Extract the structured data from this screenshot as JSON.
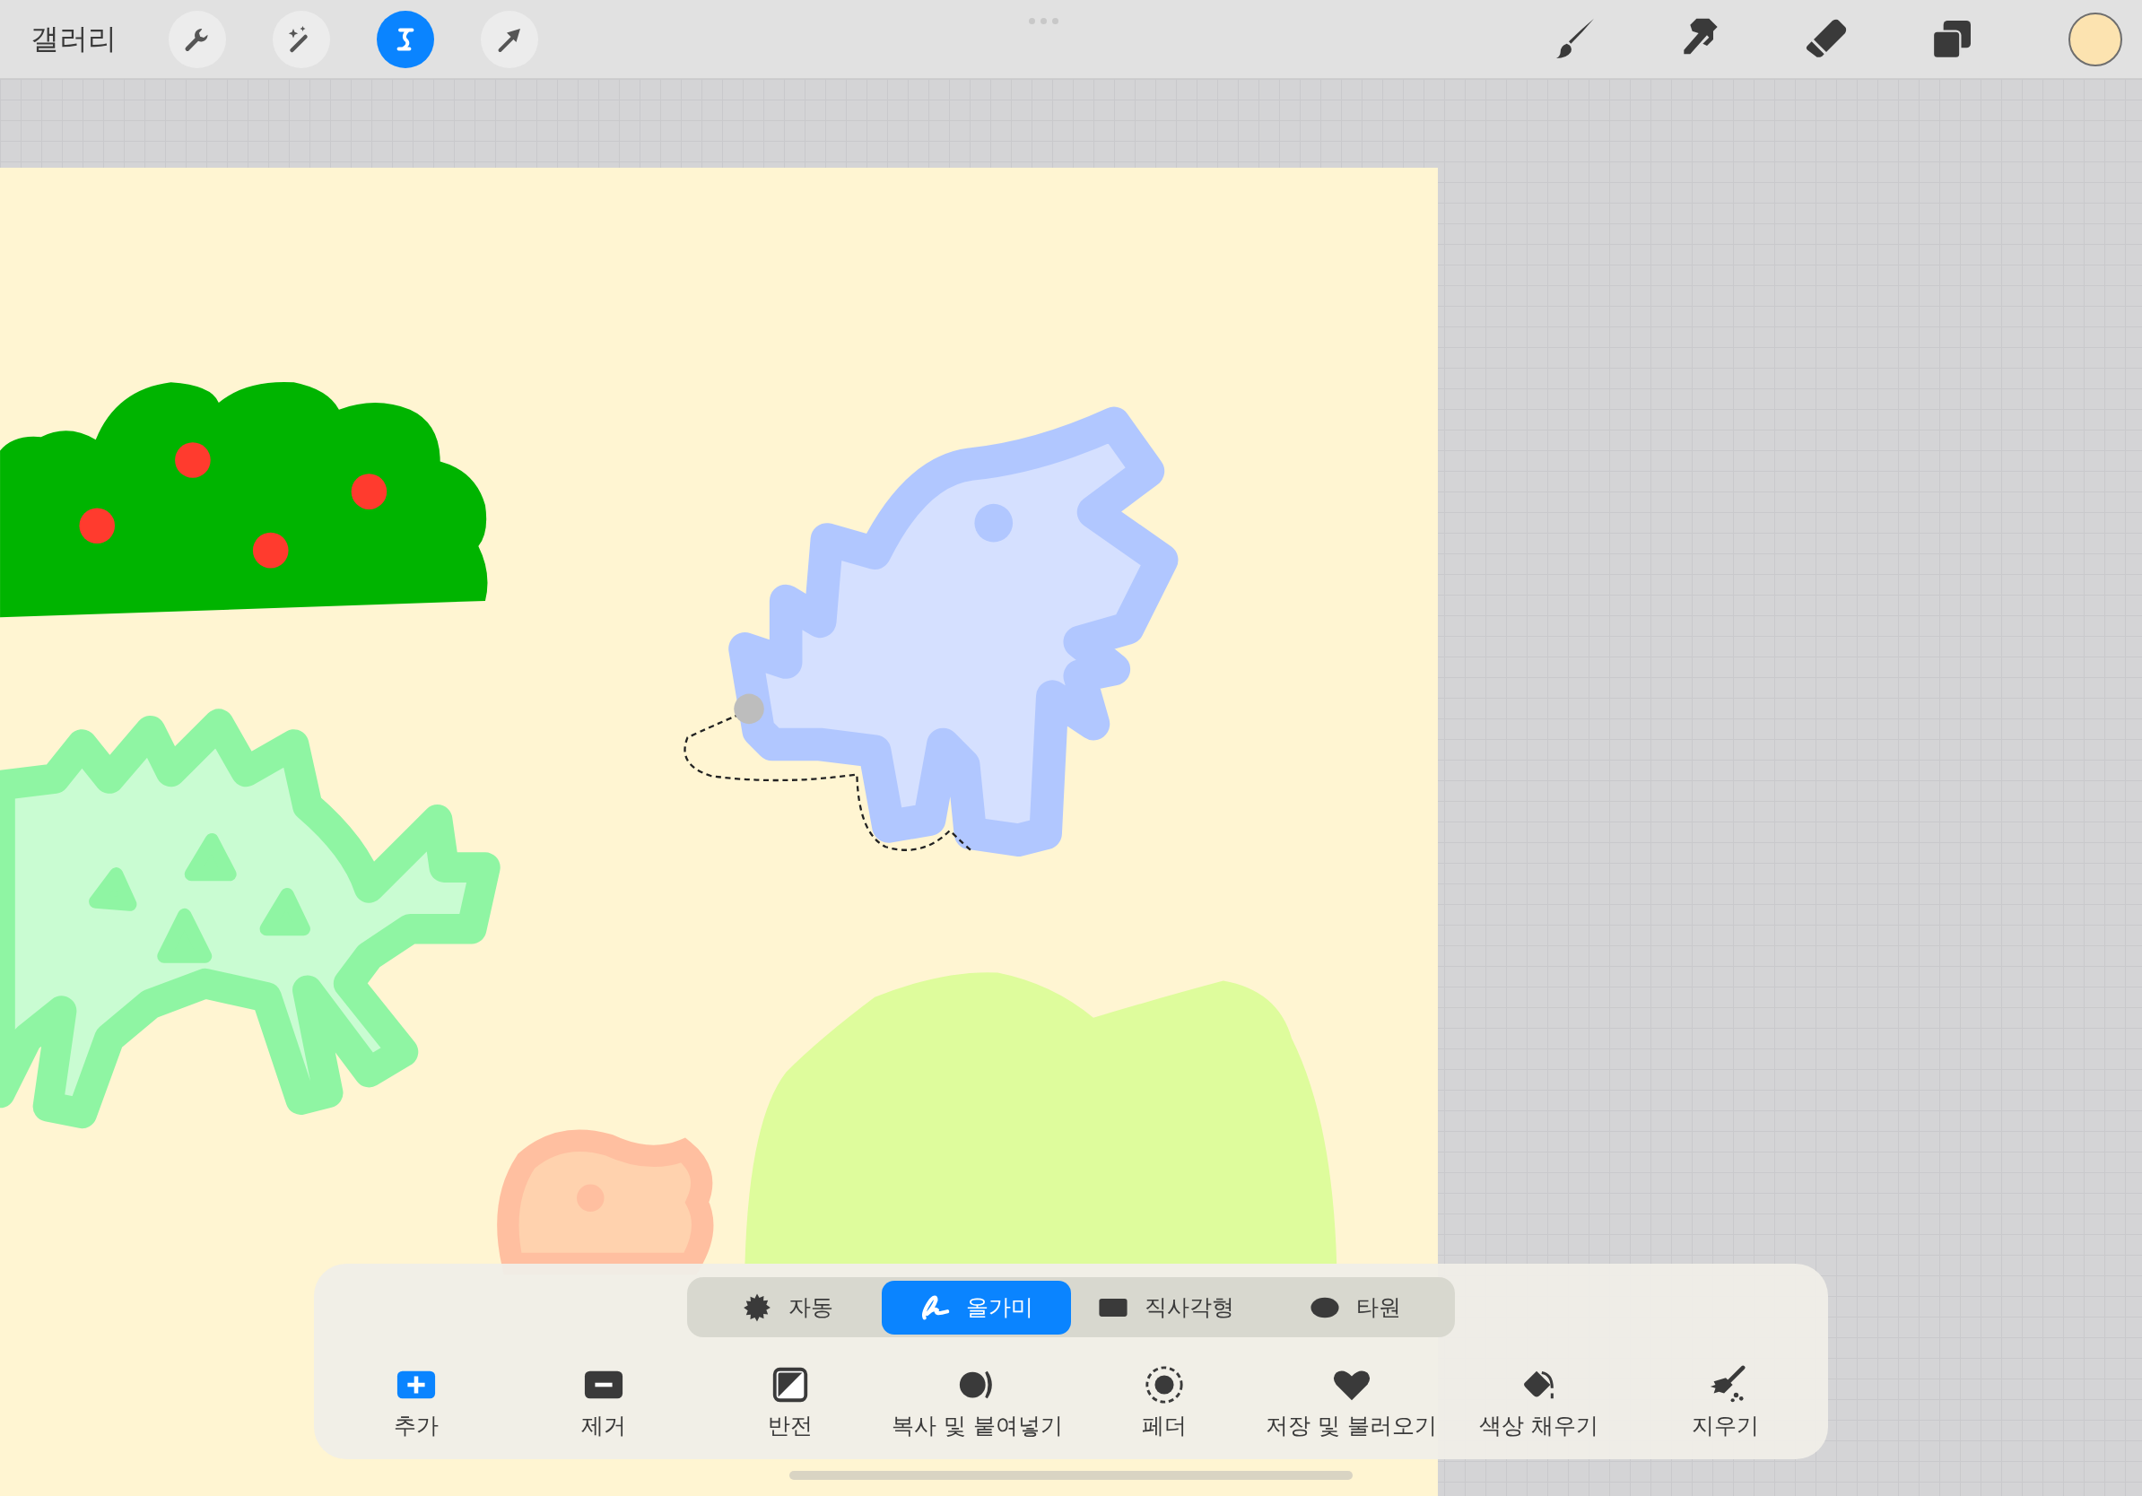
{
  "top_bar": {
    "gallery_label": "갤러리",
    "left_tools": [
      {
        "kind": "wrench",
        "selected": false
      },
      {
        "kind": "wand",
        "selected": false
      },
      {
        "kind": "selection",
        "selected": true
      },
      {
        "kind": "arrow",
        "selected": false
      }
    ],
    "right_tools": [
      {
        "kind": "brush"
      },
      {
        "kind": "smudge"
      },
      {
        "kind": "eraser"
      },
      {
        "kind": "layers"
      }
    ],
    "color_swatch": {
      "color": "#fce3b0"
    }
  },
  "selection_modes": [
    {
      "kind": "automatic",
      "label": "자동",
      "selected": false
    },
    {
      "kind": "freehand",
      "label": "올가미",
      "selected": true
    },
    {
      "kind": "rectangle",
      "label": "직사각형",
      "selected": false
    },
    {
      "kind": "ellipse",
      "label": "타원",
      "selected": false
    }
  ],
  "actions": [
    {
      "kind": "add",
      "label": "추가"
    },
    {
      "kind": "remove",
      "label": "제거"
    },
    {
      "kind": "invert",
      "label": "반전"
    },
    {
      "kind": "copy",
      "label": "복사 및 붙여넣기"
    },
    {
      "kind": "feather",
      "label": "페더"
    },
    {
      "kind": "save",
      "label": "저장 및 불러오기"
    },
    {
      "kind": "fill",
      "label": "색상 채우기"
    },
    {
      "kind": "clear",
      "label": "지우기"
    }
  ]
}
